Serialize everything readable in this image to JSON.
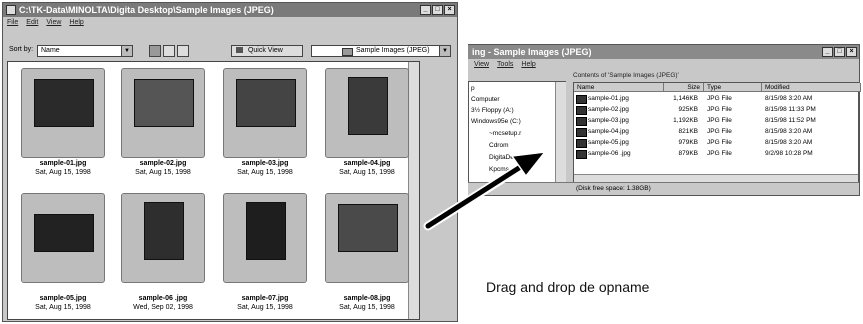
{
  "left_window": {
    "title": "C:\\TK-Data\\MINOLTA\\Digita Desktop\\Sample Images (JPEG)",
    "menu": [
      "File",
      "Edit",
      "View",
      "Help"
    ],
    "sort_label": "Sort by:",
    "sort_value": "Name",
    "quick_view_label": "Quick View",
    "folder_value": "Sample Images (JPEG)",
    "thumbnails": [
      {
        "name": "sample-01.jpg",
        "date": "Sat, Aug 15, 1998"
      },
      {
        "name": "sample-02.jpg",
        "date": "Sat, Aug 15, 1998"
      },
      {
        "name": "sample-03.jpg",
        "date": "Sat, Aug 15, 1998"
      },
      {
        "name": "sample-04.jpg",
        "date": "Sat, Aug 15, 1998"
      },
      {
        "name": "sample-05.jpg",
        "date": "Sat, Aug 15, 1998"
      },
      {
        "name": "sample-06 .jpg",
        "date": "Wed, Sep 02, 1998"
      },
      {
        "name": "sample-07.jpg",
        "date": "Sat, Aug 15, 1998"
      },
      {
        "name": "sample-08.jpg",
        "date": "Sat, Aug 15, 1998"
      }
    ]
  },
  "right_window": {
    "title": "ing - Sample Images (JPEG)",
    "menu": [
      "View",
      "Tools",
      "Help"
    ],
    "contents_label": "Contents of 'Sample Images (JPEG)'",
    "tree": [
      "p",
      "Computer",
      "3½ Floppy (A:)",
      "Windows95e (C:)",
      "~mcsetup.r",
      "Cdrom",
      "DigitaDesktop",
      "Kpcms"
    ],
    "columns": [
      "Name",
      "Size",
      "Type",
      "Modified"
    ],
    "files": [
      {
        "name": "sample-01.jpg",
        "size": "1,146KB",
        "type": "JPG File",
        "modified": "8/15/98 3:20 AM"
      },
      {
        "name": "sample-02.jpg",
        "size": "925KB",
        "type": "JPG File",
        "modified": "8/15/98 11:33 PM"
      },
      {
        "name": "sample-03.jpg",
        "size": "1,192KB",
        "type": "JPG File",
        "modified": "8/15/98 11:52 PM"
      },
      {
        "name": "sample-04.jpg",
        "size": "821KB",
        "type": "JPG File",
        "modified": "8/15/98 3:20 AM"
      },
      {
        "name": "sample-05.jpg",
        "size": "979KB",
        "type": "JPG File",
        "modified": "8/15/98 3:20 AM"
      },
      {
        "name": "sample-06 .jpg",
        "size": "879KB",
        "type": "JPG File",
        "modified": "9/2/98 10:28 PM"
      }
    ],
    "status": "(Disk free space: 1.38GB)"
  },
  "caption": "Drag and drop de opname"
}
